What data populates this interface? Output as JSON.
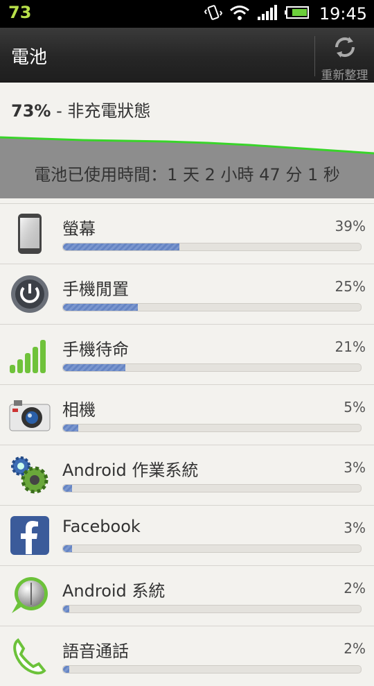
{
  "status_bar": {
    "battery_number": "73",
    "time": "19:45"
  },
  "header": {
    "title": "電池",
    "refresh_label": "重新整理"
  },
  "battery": {
    "percent_text": "73%",
    "state_text": " - 非充電狀態",
    "usage_time_text": "電池已使用時間：1 天 2 小時 47 分 1 秒"
  },
  "items": [
    {
      "label": "螢幕",
      "percent_text": "39%",
      "value": 39,
      "icon": "phone-screen-icon"
    },
    {
      "label": "手機閒置",
      "percent_text": "25%",
      "value": 25,
      "icon": "power-button-icon"
    },
    {
      "label": "手機待命",
      "percent_text": "21%",
      "value": 21,
      "icon": "signal-bars-icon"
    },
    {
      "label": "相機",
      "percent_text": "5%",
      "value": 5,
      "icon": "camera-icon"
    },
    {
      "label": "Android 作業系統",
      "percent_text": "3%",
      "value": 3,
      "icon": "gears-icon"
    },
    {
      "label": "Facebook",
      "percent_text": "3%",
      "value": 3,
      "icon": "facebook-icon"
    },
    {
      "label": "Android 系統",
      "percent_text": "2%",
      "value": 2,
      "icon": "android-system-icon"
    },
    {
      "label": "語音通話",
      "percent_text": "2%",
      "value": 2,
      "icon": "phone-call-icon"
    }
  ],
  "colors": {
    "bar_fill": "#7b97cf",
    "graph_line": "#39d42a",
    "battery_green": "#b8e04a"
  }
}
